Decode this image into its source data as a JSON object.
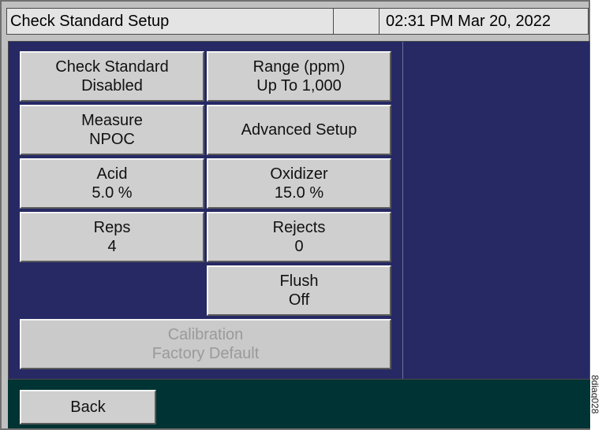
{
  "header": {
    "title": "Check Standard Setup",
    "clock": "02:31 PM Mar 20, 2022"
  },
  "buttons": {
    "check_standard": {
      "line1": "Check Standard",
      "line2": "Disabled"
    },
    "range": {
      "line1": "Range (ppm)",
      "line2": "Up To 1,000"
    },
    "measure": {
      "line1": "Measure",
      "line2": "NPOC"
    },
    "advanced_setup": {
      "label": "Advanced Setup"
    },
    "acid": {
      "line1": "Acid",
      "line2": "5.0 %"
    },
    "oxidizer": {
      "line1": "Oxidizer",
      "line2": "15.0 %"
    },
    "reps": {
      "line1": "Reps",
      "line2": "4"
    },
    "rejects": {
      "line1": "Rejects",
      "line2": "0"
    },
    "flush": {
      "line1": "Flush",
      "line2": "Off"
    },
    "calibration": {
      "line1": "Calibration",
      "line2": "Factory Default",
      "disabled": true
    }
  },
  "footer": {
    "back_label": "Back"
  },
  "figure_code": "8diag028",
  "colors": {
    "main_panel": "#262964",
    "footer": "#003333",
    "button": "#cfcfcf",
    "titlebar": "#e4e4e4"
  }
}
